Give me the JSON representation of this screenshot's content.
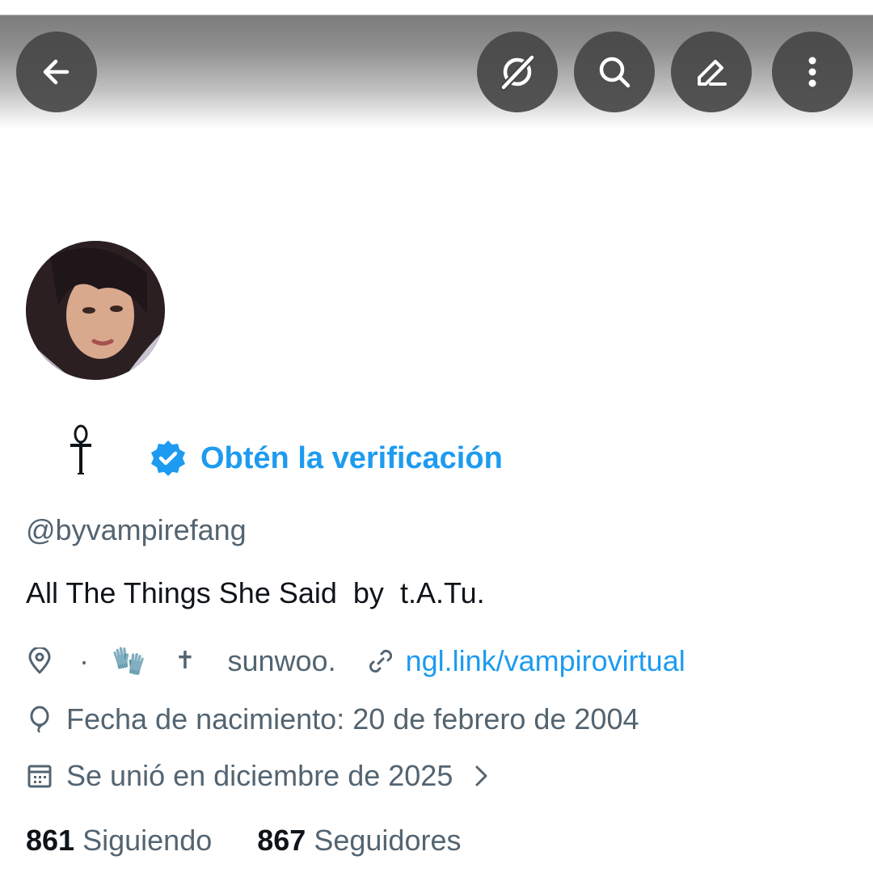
{
  "header": {
    "buttons": [
      {
        "name": "back",
        "icon": "arrow-left-icon"
      },
      {
        "name": "grok",
        "icon": "grok-icon"
      },
      {
        "name": "search",
        "icon": "search-icon"
      },
      {
        "name": "edit",
        "icon": "pencil-icon"
      },
      {
        "name": "more",
        "icon": "more-vertical-icon"
      }
    ]
  },
  "profile": {
    "display_name_symbol": "☥",
    "verify_label": "Obtén la verificación",
    "handle": "@byvampirefang",
    "bio": "All The Things She Said  by  t.A.Tu.",
    "location": {
      "emoji1": "🧤",
      "emoji2": "✝",
      "text": "sunwoo."
    },
    "website": "ngl.link/vampirovirtual",
    "birthdate": "Fecha de nacimiento: 20 de febrero de 2004",
    "joined": "Se unió en diciembre de 2025",
    "following_count": "861",
    "following_label": "Siguiendo",
    "followers_count": "867",
    "followers_label": "Seguidores"
  },
  "colors": {
    "accent": "#1d9bf0",
    "secondary_text": "#536471",
    "primary_text": "#0f1419"
  }
}
